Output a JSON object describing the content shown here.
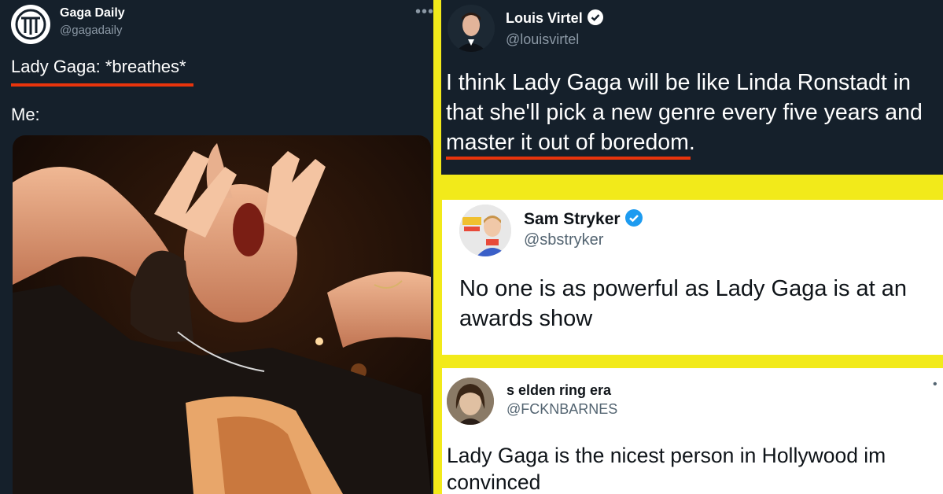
{
  "left_tweet": {
    "display_name": "Gaga Daily",
    "handle": "@gagadaily",
    "more_icon": "ellipsis-icon",
    "line1": "Lady Gaga: *breathes*",
    "line2": "Me:",
    "media_description_icon": "photo"
  },
  "right_top_tweet": {
    "display_name": "Louis Virtel",
    "handle": "@louisvirtel",
    "verified": true,
    "text": "I think Lady Gaga will be like Linda Ronstadt in that she'll pick a new genre every five years and master it out of boredom."
  },
  "right_middle_tweet": {
    "display_name": "Sam Stryker",
    "handle": "@sbstryker",
    "verified": true,
    "text": "No one is as powerful as Lady Gaga is at an awards show"
  },
  "right_bottom_tweet": {
    "display_name": "s elden ring era",
    "handle": "@FCKNBARNES",
    "text": "Lady Gaga is the nicest person in Hollywood im convinced"
  },
  "colors": {
    "background": "#f2ea1a",
    "dark_card": "#15202b",
    "light_card": "#ffffff",
    "underline": "#e8340c",
    "verified": "#1d9bf0"
  }
}
